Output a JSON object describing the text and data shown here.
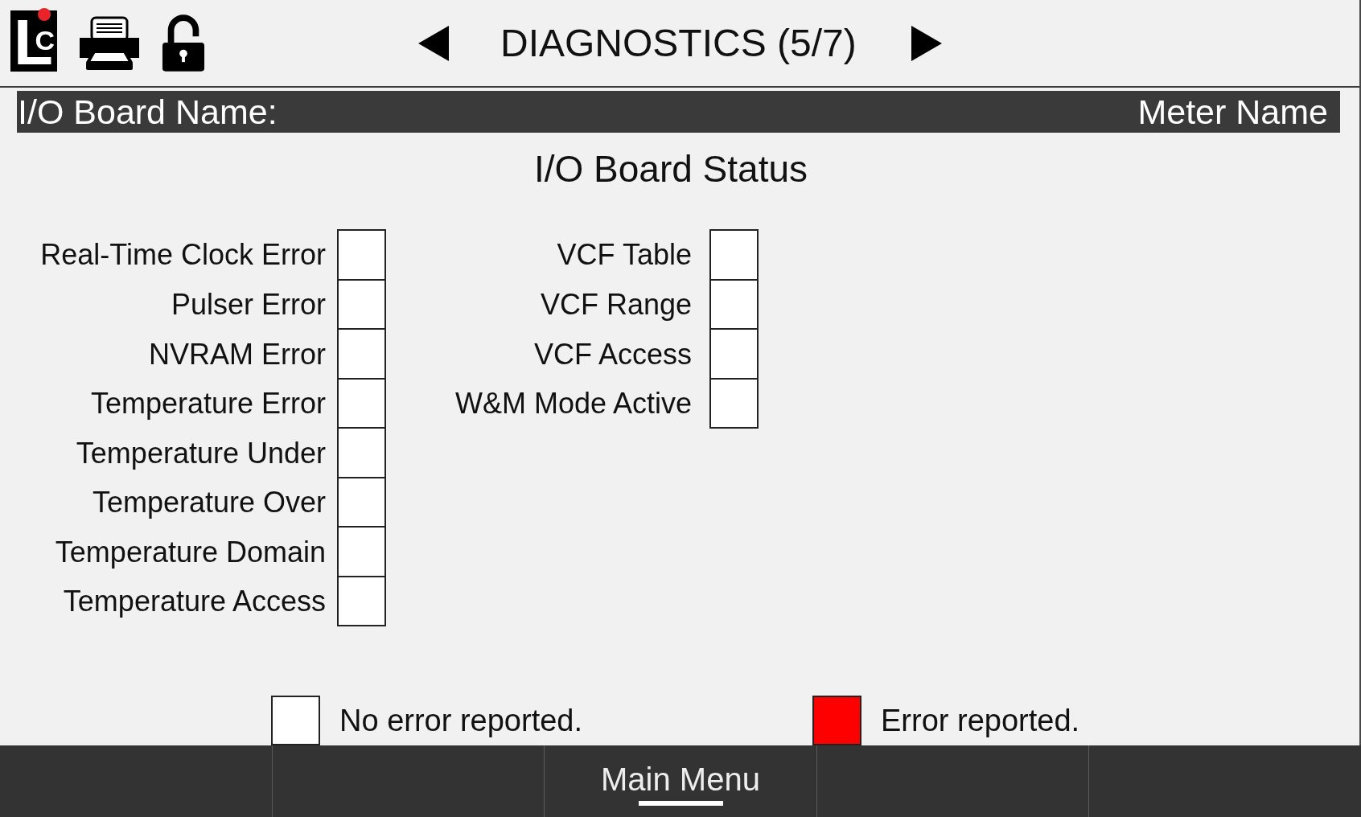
{
  "logo": {
    "letters": [
      "L",
      "C"
    ],
    "alert": true
  },
  "lock": {
    "locked": false
  },
  "nav": {
    "title": "DIAGNOSTICS (5/7)"
  },
  "header": {
    "board_label": "I/O Board Name:",
    "meter_name": "Meter Name"
  },
  "section_title": "I/O Board Status",
  "status_columns": [
    {
      "items": [
        {
          "label": "Real-Time Clock Error",
          "error": false
        },
        {
          "label": "Pulser Error",
          "error": false
        },
        {
          "label": "NVRAM Error",
          "error": false
        },
        {
          "label": "Temperature Error",
          "error": false
        },
        {
          "label": "Temperature Under",
          "error": false
        },
        {
          "label": "Temperature Over",
          "error": false
        },
        {
          "label": "Temperature Domain",
          "error": false
        },
        {
          "label": "Temperature Access",
          "error": false
        }
      ]
    },
    {
      "items": [
        {
          "label": "VCF Table",
          "error": false
        },
        {
          "label": "VCF Range",
          "error": false
        },
        {
          "label": "VCF Access",
          "error": false
        },
        {
          "label": "W&M Mode Active",
          "error": false
        }
      ]
    }
  ],
  "legend": [
    {
      "label": "No error reported.",
      "color": "#ffffff"
    },
    {
      "label": "Error reported.",
      "color": "#ff0000"
    }
  ],
  "softkeys": [
    {
      "kind": "blank"
    },
    {
      "kind": "blank"
    },
    {
      "kind": "button",
      "label": "Main Menu",
      "selected": true
    },
    {
      "kind": "blank"
    },
    {
      "kind": "blank"
    }
  ]
}
